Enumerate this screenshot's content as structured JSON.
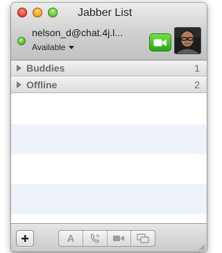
{
  "window": {
    "title": "Jabber List"
  },
  "account": {
    "name": "nelson_d@chat.4j.l...",
    "status": "Available",
    "status_color": "#4fbf2a"
  },
  "groups": [
    {
      "label": "Buddies",
      "count": "1"
    },
    {
      "label": "Offline",
      "count": "2"
    }
  ],
  "toolbar": {
    "add_icon": "plus-icon",
    "text_chat_letter": "A",
    "buttons": [
      "add-button",
      "text-chat-button",
      "audio-chat-button",
      "video-chat-button",
      "screen-share-button"
    ]
  },
  "colors": {
    "facetime_green": "#3fc41f",
    "list_stripe": "#eef3fb"
  }
}
